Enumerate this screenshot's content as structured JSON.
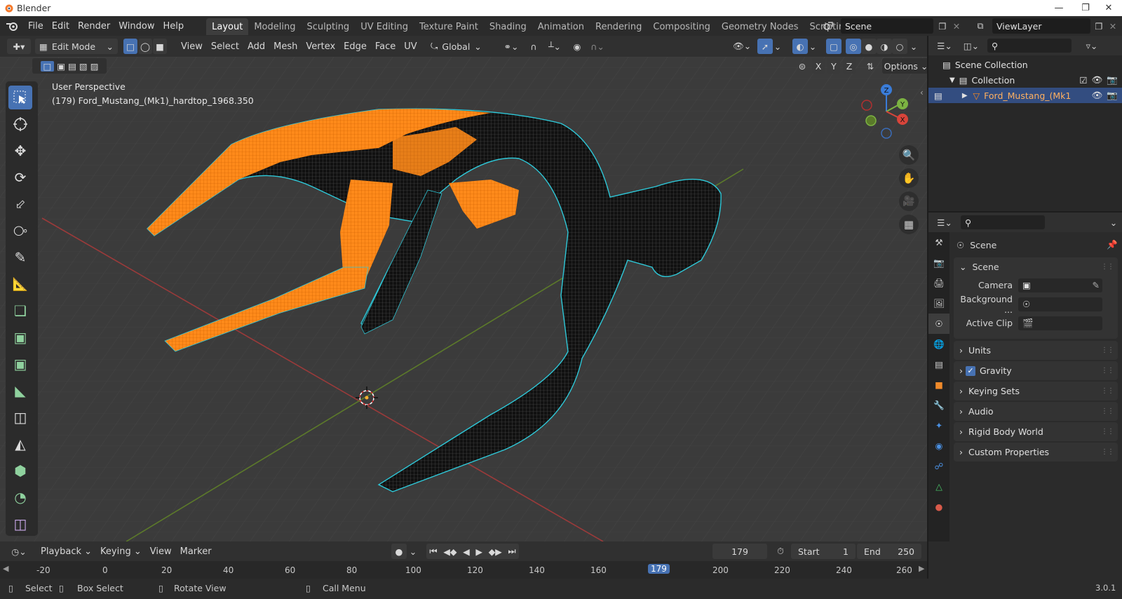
{
  "window": {
    "title": "Blender"
  },
  "menu": [
    "File",
    "Edit",
    "Render",
    "Window",
    "Help"
  ],
  "workspaces": [
    "Layout",
    "Modeling",
    "Sculpting",
    "UV Editing",
    "Texture Paint",
    "Shading",
    "Animation",
    "Rendering",
    "Compositing",
    "Geometry Nodes",
    "Scripting"
  ],
  "scene_field": "Scene",
  "viewlayer_field": "ViewLayer",
  "viewport_header": {
    "mode": "Edit Mode",
    "menus": [
      "View",
      "Select",
      "Add",
      "Mesh",
      "Vertex",
      "Edge",
      "Face",
      "UV"
    ],
    "orientation": "Global",
    "axis_x": "X",
    "axis_y": "Y",
    "axis_z": "Z",
    "options": "Options"
  },
  "viewport": {
    "perspective": "User Perspective",
    "object_info": "(179) Ford_Mustang_(Mk1)_hardtop_1968.350",
    "gizmo": {
      "x": "X",
      "y": "Y",
      "z": "Z"
    }
  },
  "outliner": {
    "scene_collection": "Scene Collection",
    "collection": "Collection",
    "object": "Ford_Mustang_(Mk1"
  },
  "properties": {
    "title": "Scene",
    "section_scene": "Scene",
    "camera_label": "Camera",
    "background_label": "Background ...",
    "active_clip_label": "Active Clip",
    "panels": [
      "Units",
      "Gravity",
      "Keying Sets",
      "Audio",
      "Rigid Body World",
      "Custom Properties"
    ]
  },
  "timeline": {
    "menus": [
      "Playback",
      "Keying",
      "View",
      "Marker"
    ],
    "current_frame": "179",
    "start_label": "Start",
    "start": "1",
    "end_label": "End",
    "end": "250",
    "ticks": [
      "-20",
      "0",
      "20",
      "40",
      "60",
      "80",
      "100",
      "120",
      "140",
      "160",
      "179",
      "200",
      "220",
      "240",
      "260"
    ]
  },
  "statusbar": {
    "select": "Select",
    "box_select": "Box Select",
    "rotate_view": "Rotate View",
    "call_menu": "Call Menu",
    "version": "3.0.1"
  },
  "colors": {
    "accent": "#4772b3",
    "selected": "#ff8a1a",
    "edge_highlight": "#2ec8d8"
  }
}
